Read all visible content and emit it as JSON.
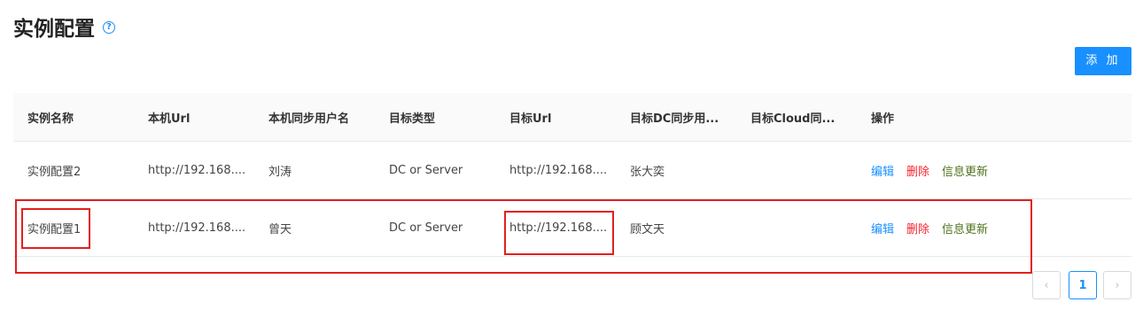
{
  "header": {
    "title": "实例配置",
    "help_icon": "question-circle-icon"
  },
  "toolbar": {
    "add_label": "添 加"
  },
  "table": {
    "columns": [
      "实例名称",
      "本机Url",
      "本机同步用户名",
      "目标类型",
      "目标Url",
      "目标DC同步用...",
      "目标Cloud同...",
      "操作"
    ],
    "rows": [
      {
        "name": "实例配置2",
        "local_url": "http://192.168....",
        "local_user": "刘涛",
        "target_type": "DC or Server",
        "target_url": "http://192.168....",
        "dc_user": "张大奕",
        "cloud_user": "",
        "actions": {
          "edit": "编辑",
          "delete": "删除",
          "update": "信息更新"
        }
      },
      {
        "name": "实例配置1",
        "local_url": "http://192.168....",
        "local_user": "曾天",
        "target_type": "DC or Server",
        "target_url": "http://192.168....",
        "dc_user": "顾文天",
        "cloud_user": "",
        "actions": {
          "edit": "编辑",
          "delete": "删除",
          "update": "信息更新"
        }
      }
    ]
  },
  "pagination": {
    "prev": "‹",
    "current": "1",
    "next": "›"
  },
  "colors": {
    "accent": "#1890ff",
    "danger": "#f5222d",
    "update": "#52731e",
    "highlight": "#e02020"
  }
}
